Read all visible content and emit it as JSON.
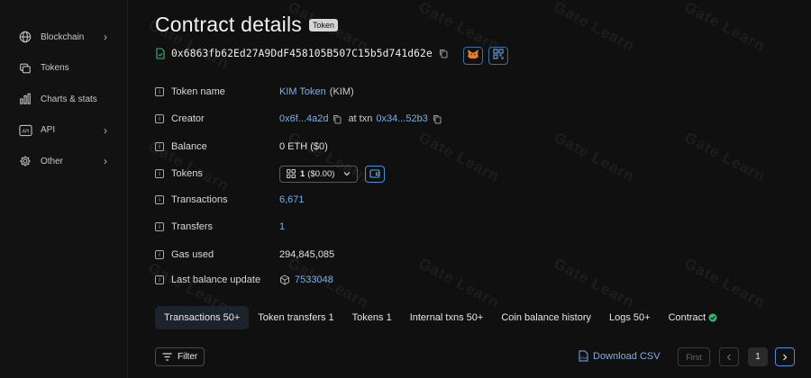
{
  "sidebar": {
    "items": [
      {
        "label": "Blockchain",
        "icon": "globe-icon",
        "has_chevron": true
      },
      {
        "label": "Tokens",
        "icon": "tokens-icon",
        "has_chevron": false
      },
      {
        "label": "Charts & stats",
        "icon": "bar-chart-icon",
        "has_chevron": false
      },
      {
        "label": "API",
        "icon": "api-icon",
        "has_chevron": true
      },
      {
        "label": "Other",
        "icon": "gear-icon",
        "has_chevron": true
      }
    ],
    "chevron": "›"
  },
  "header": {
    "title": "Contract details",
    "badge": "Token",
    "address": "0x6863fb62Ed27A9DdF458105B507C15b5d741d62e"
  },
  "details": {
    "token_name": {
      "label": "Token name",
      "link": "KIM Token",
      "suffix": "(KIM)"
    },
    "creator": {
      "label": "Creator",
      "address": "0x6f...4a2d",
      "at_txn": "at txn",
      "txn": "0x34...52b3"
    },
    "balance": {
      "label": "Balance",
      "value": "0 ETH ($0)"
    },
    "tokens": {
      "label": "Tokens",
      "count": "1",
      "usd": "($0.00)"
    },
    "transactions": {
      "label": "Transactions",
      "value": "6,671"
    },
    "transfers": {
      "label": "Transfers",
      "value": "1"
    },
    "gas_used": {
      "label": "Gas used",
      "value": "294,845,085"
    },
    "last_balance_update": {
      "label": "Last balance update",
      "value": "7533048"
    }
  },
  "tabs": [
    {
      "label": "Transactions 50+",
      "active": true
    },
    {
      "label": "Token transfers 1",
      "active": false
    },
    {
      "label": "Tokens 1",
      "active": false
    },
    {
      "label": "Internal txns 50+",
      "active": false
    },
    {
      "label": "Coin balance history",
      "active": false
    },
    {
      "label": "Logs 50+",
      "active": false
    },
    {
      "label": "Contract",
      "active": false
    }
  ],
  "toolbar": {
    "filter_label": "Filter",
    "download_label": "Download CSV",
    "first_label": "First",
    "current_page": "1"
  },
  "watermark_text": "Gate Learn",
  "colors": {
    "background": "#101010",
    "link": "#7bb0e8",
    "accent_border": "#4b8fd6",
    "verified": "#2dbd6e"
  }
}
